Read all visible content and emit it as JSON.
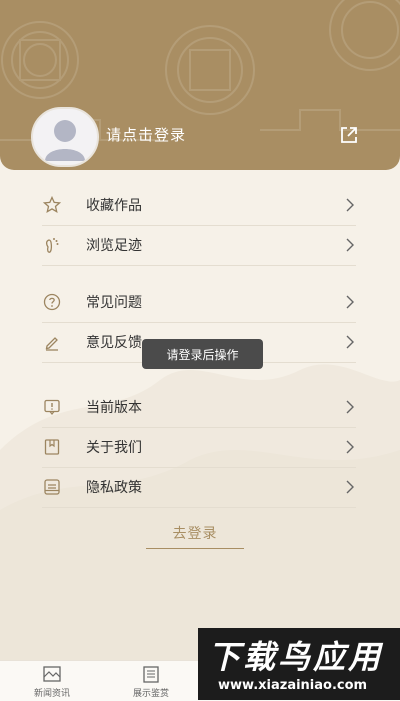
{
  "header": {
    "login_prompt": "请点击登录",
    "share_icon": "share-out-icon",
    "bg_color": "#a98e63"
  },
  "menu": {
    "group1": [
      {
        "label": "收藏作品",
        "icon": "star-icon"
      },
      {
        "label": "浏览足迹",
        "icon": "footprint-icon"
      }
    ],
    "group2": [
      {
        "label": "常见问题",
        "icon": "question-icon"
      },
      {
        "label": "意见反馈",
        "icon": "edit-icon"
      }
    ],
    "group3": [
      {
        "label": "当前版本",
        "icon": "info-icon"
      },
      {
        "label": "关于我们",
        "icon": "bookmark-icon"
      },
      {
        "label": "隐私政策",
        "icon": "document-icon"
      }
    ]
  },
  "toast": "请登录后操作",
  "logout_label": "去登录",
  "tabbar": [
    {
      "label": "新闻资讯",
      "icon": "news-icon"
    },
    {
      "label": "展示鉴赏",
      "icon": "gallery-icon"
    }
  ],
  "watermark": {
    "title": "下载鸟应用",
    "url": "www.xiazainiao.com"
  },
  "colors": {
    "accent": "#a88e63",
    "background": "#f6f1e8"
  }
}
